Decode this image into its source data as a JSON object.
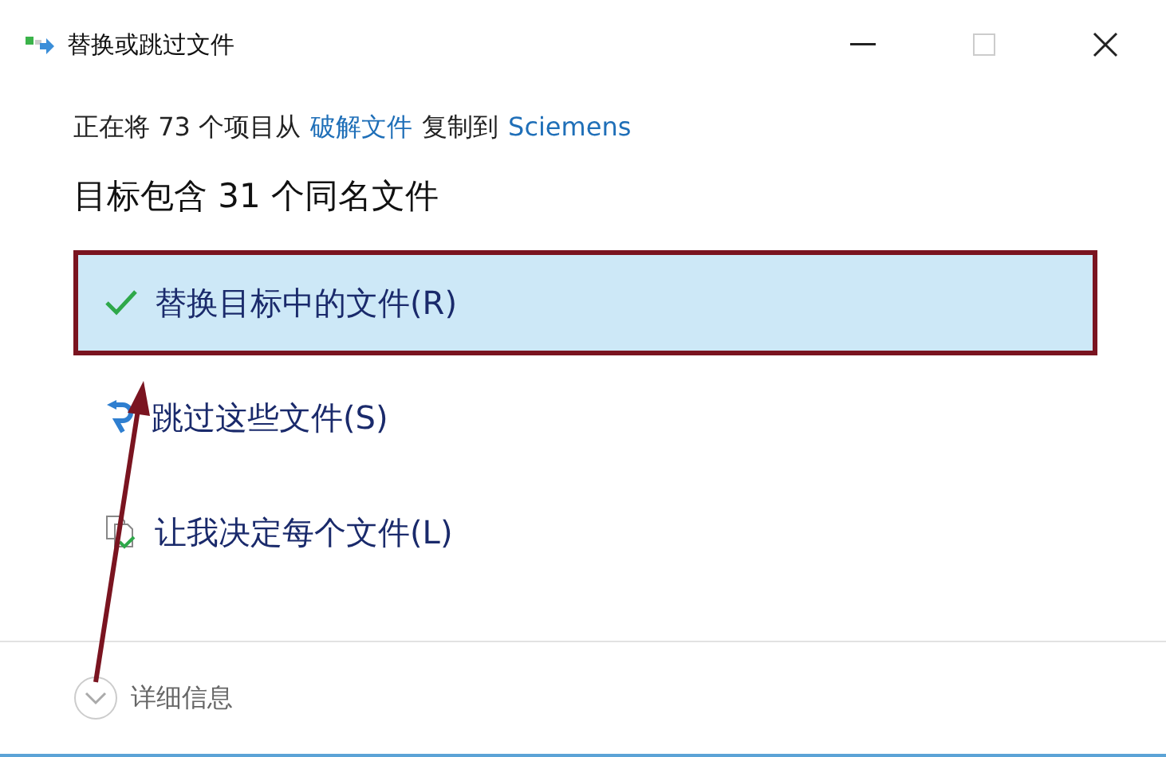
{
  "window": {
    "title": "替换或跳过文件"
  },
  "message": {
    "prefix": "正在将 73 个项目从",
    "source": "破解文件",
    "middle": "复制到",
    "destination": "Sciemens"
  },
  "heading": "目标包含 31 个同名文件",
  "options": [
    {
      "kind": "replace",
      "label": "替换目标中的文件(R)",
      "selected": true
    },
    {
      "kind": "skip",
      "label": "跳过这些文件(S)",
      "selected": false
    },
    {
      "kind": "decide",
      "label": "让我决定每个文件(L)",
      "selected": false
    }
  ],
  "details": {
    "label": "详细信息",
    "expanded": false
  }
}
